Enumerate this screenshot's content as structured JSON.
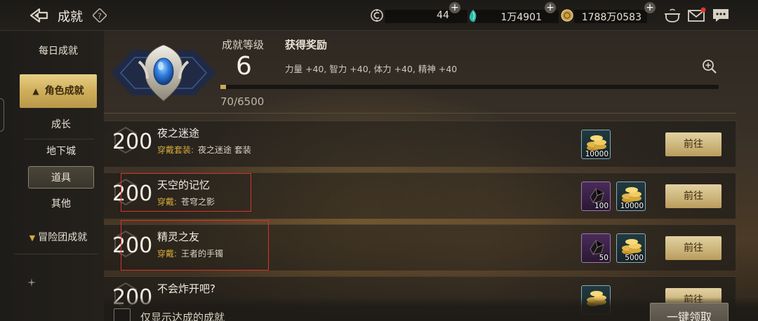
{
  "topbar": {
    "title": "成就",
    "resources": [
      {
        "value": "44",
        "icon": "c-coin-icon"
      },
      {
        "value": "1万4901",
        "icon": "teal-crystal-icon"
      },
      {
        "value": "1788万0583",
        "icon": "gold-coin-icon"
      }
    ]
  },
  "sidebar": {
    "daily": "每日成就",
    "character": "角色成就",
    "subs": [
      "成长",
      "地下城",
      "道具",
      "其他"
    ],
    "adventure": "冒险团成就"
  },
  "header": {
    "level_label": "成就等级",
    "level_value": "6",
    "reward_label": "获得奖励",
    "reward_text": "力量 +40, 智力 +40, 体力 +40, 精神 +40",
    "progress_text": "70/6500",
    "progress_fraction": 0.0108
  },
  "rows": [
    {
      "points": "200",
      "name": "夜之迷途",
      "req_label": "穿戴套装:",
      "req_value": "夜之迷途 套装",
      "rewards": [
        {
          "kind": "gold",
          "qty": "10000"
        }
      ],
      "button": "前往"
    },
    {
      "points": "200",
      "name": "天空的记忆",
      "req_label": "穿戴:",
      "req_value": "苍穹之影",
      "rewards": [
        {
          "kind": "purple",
          "qty": "100"
        },
        {
          "kind": "gold",
          "qty": "10000"
        }
      ],
      "button": "前往"
    },
    {
      "points": "200",
      "name": "精灵之友",
      "req_label": "穿戴:",
      "req_value": "王者的手镯",
      "rewards": [
        {
          "kind": "purple",
          "qty": "50"
        },
        {
          "kind": "gold",
          "qty": "5000"
        }
      ],
      "button": "前往"
    },
    {
      "points": "200",
      "name": "不会炸开吧?",
      "req_label": "",
      "req_value": "",
      "rewards": [
        {
          "kind": "gold",
          "qty": ""
        }
      ],
      "button": "前往"
    }
  ],
  "bottom": {
    "filter_label": "仅显示达成的成就",
    "collect_all": "一键领取"
  },
  "colors": {
    "gold_accent": "#c9a959",
    "requirement_label": "#d5a93a",
    "highlight_box": "#d9322c"
  }
}
